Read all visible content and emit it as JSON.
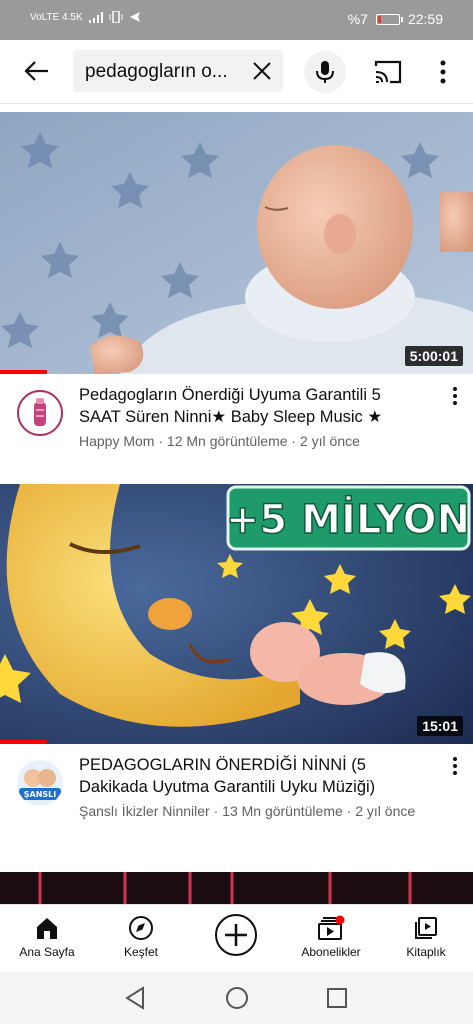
{
  "status_bar": {
    "left": "VoLTE 4.5K",
    "battery_percent": "%7",
    "time": "22:59"
  },
  "header": {
    "search_value": "pedagogların o...",
    "icons": [
      "back-arrow-icon",
      "clear-icon",
      "mic-icon",
      "cast-icon",
      "more-vert-icon"
    ]
  },
  "videos": [
    {
      "title": "Pedagogların Önerdiği Uyuma Garantili 5 SAAT Süren Ninni★ Baby Sleep Music ★",
      "meta": "Happy Mom · 12 Mn görüntüleme · 2 yıl önce",
      "duration": "5:00:01",
      "watched_fraction": 0.1
    },
    {
      "title": "PEDAGOGLARIN ÖNERDİĞİ NİNNİ (5 Dakikada Uyutma Garantili Uyku Müziği)",
      "meta": "Şanslı İkizler Ninniler · 13 Mn görüntüleme · 2 yıl önce",
      "duration": "15:01",
      "watched_fraction": 0.1,
      "thumbnail_text": "+5 MİLYON",
      "avatar_text": "ŞANSLI"
    }
  ],
  "bottom_nav": {
    "items": [
      {
        "label": "Ana Sayfa",
        "icon": "home-icon"
      },
      {
        "label": "Keşfet",
        "icon": "explore-icon"
      },
      {
        "label": "",
        "icon": "create-icon"
      },
      {
        "label": "Abonelikler",
        "icon": "subscriptions-icon"
      },
      {
        "label": "Kitaplık",
        "icon": "library-icon"
      }
    ]
  },
  "colors": {
    "accent": "#ff0000",
    "text": "#0f0f0f",
    "secondary_text": "#606060",
    "status_bar": "#9a9a9a"
  }
}
